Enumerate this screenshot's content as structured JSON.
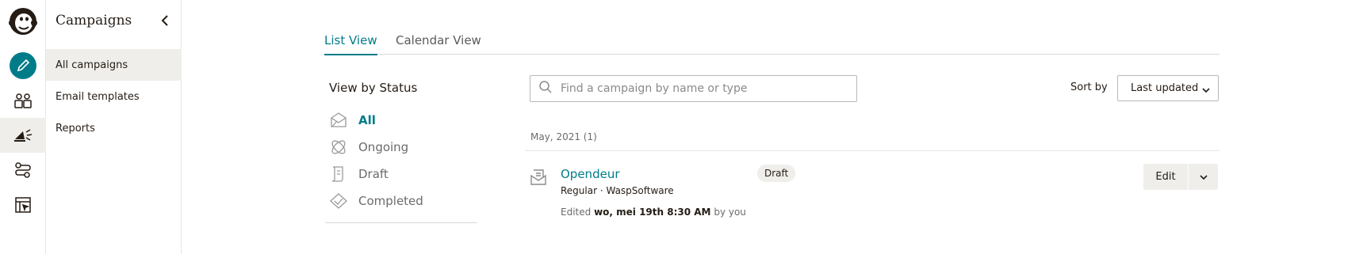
{
  "rail": {
    "items": [
      {
        "icon": "mailchimp-logo-icon"
      },
      {
        "icon": "create-pencil-icon"
      },
      {
        "icon": "audience-icon"
      },
      {
        "icon": "campaigns-megaphone-icon"
      },
      {
        "icon": "automations-icon"
      },
      {
        "icon": "website-icon"
      }
    ]
  },
  "nav": {
    "title": "Campaigns",
    "items": [
      {
        "label": "All campaigns"
      },
      {
        "label": "Email templates"
      },
      {
        "label": "Reports"
      }
    ]
  },
  "tabs": [
    {
      "label": "List View"
    },
    {
      "label": "Calendar View"
    }
  ],
  "status": {
    "title": "View by Status",
    "items": [
      {
        "label": "All",
        "icon": "all-campaigns-icon"
      },
      {
        "label": "Ongoing",
        "icon": "ongoing-icon"
      },
      {
        "label": "Draft",
        "icon": "draft-icon"
      },
      {
        "label": "Completed",
        "icon": "completed-icon"
      }
    ]
  },
  "search": {
    "placeholder": "Find a campaign by name or type",
    "value": ""
  },
  "sort": {
    "label": "Sort by",
    "value": "Last updated"
  },
  "group": {
    "label": "May, 2021 (1)"
  },
  "campaign": {
    "title": "Opendeur",
    "meta": "Regular · WaspSoftware",
    "edited_prefix": "Edited",
    "edited_date": "wo, mei 19th 8:30 AM",
    "edited_suffix": "by you",
    "status_badge": "Draft",
    "edit_label": "Edit"
  },
  "colors": {
    "accent": "#007c89",
    "active_bg": "#efeeea",
    "text": "#241c15"
  }
}
